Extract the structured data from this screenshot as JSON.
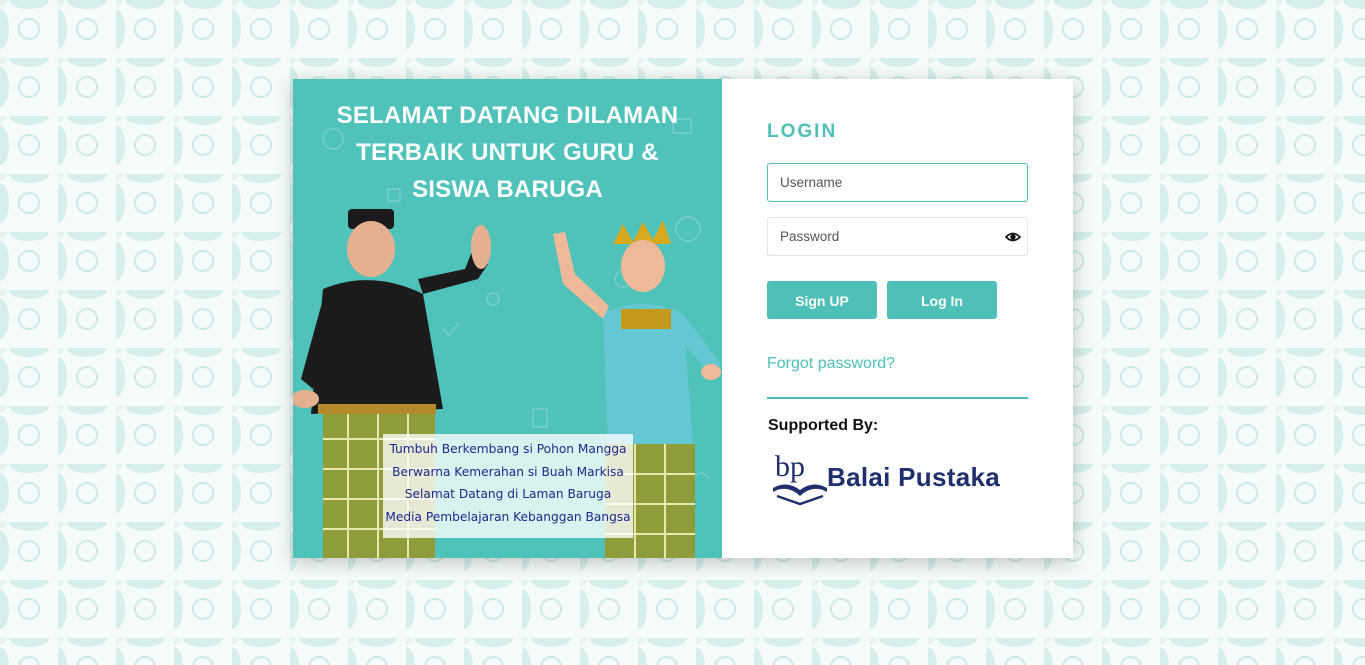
{
  "hero": {
    "title_line1": "SELAMAT DATANG DILAMAN",
    "title_line2": "TERBAIK UNTUK GURU &",
    "title_line3": "SISWA BARUGA",
    "poem": [
      "Tumbuh Berkembang si Pohon Mangga",
      "Berwarna Kemerahan si Buah Markisa",
      "Selamat Datang di Laman Baruga",
      "Media Pembelajaran Kebanggan Bangsa"
    ]
  },
  "login": {
    "title": "LOGIN",
    "username_placeholder": "Username",
    "password_placeholder": "Password",
    "signup_label": "Sign UP",
    "login_label": "Log In",
    "forgot_label": "Forgot password?",
    "supported_label": "Supported By:",
    "brand_name": "Balai Pustaka",
    "brand_logo_text": "bp"
  },
  "colors": {
    "accent": "#4ec0b7",
    "brand_navy": "#1f2f6e",
    "poem_text": "#1d2a8c"
  },
  "icons": {
    "password_toggle": "eye-icon",
    "brand_logo": "balai-pustaka-book-logo"
  }
}
